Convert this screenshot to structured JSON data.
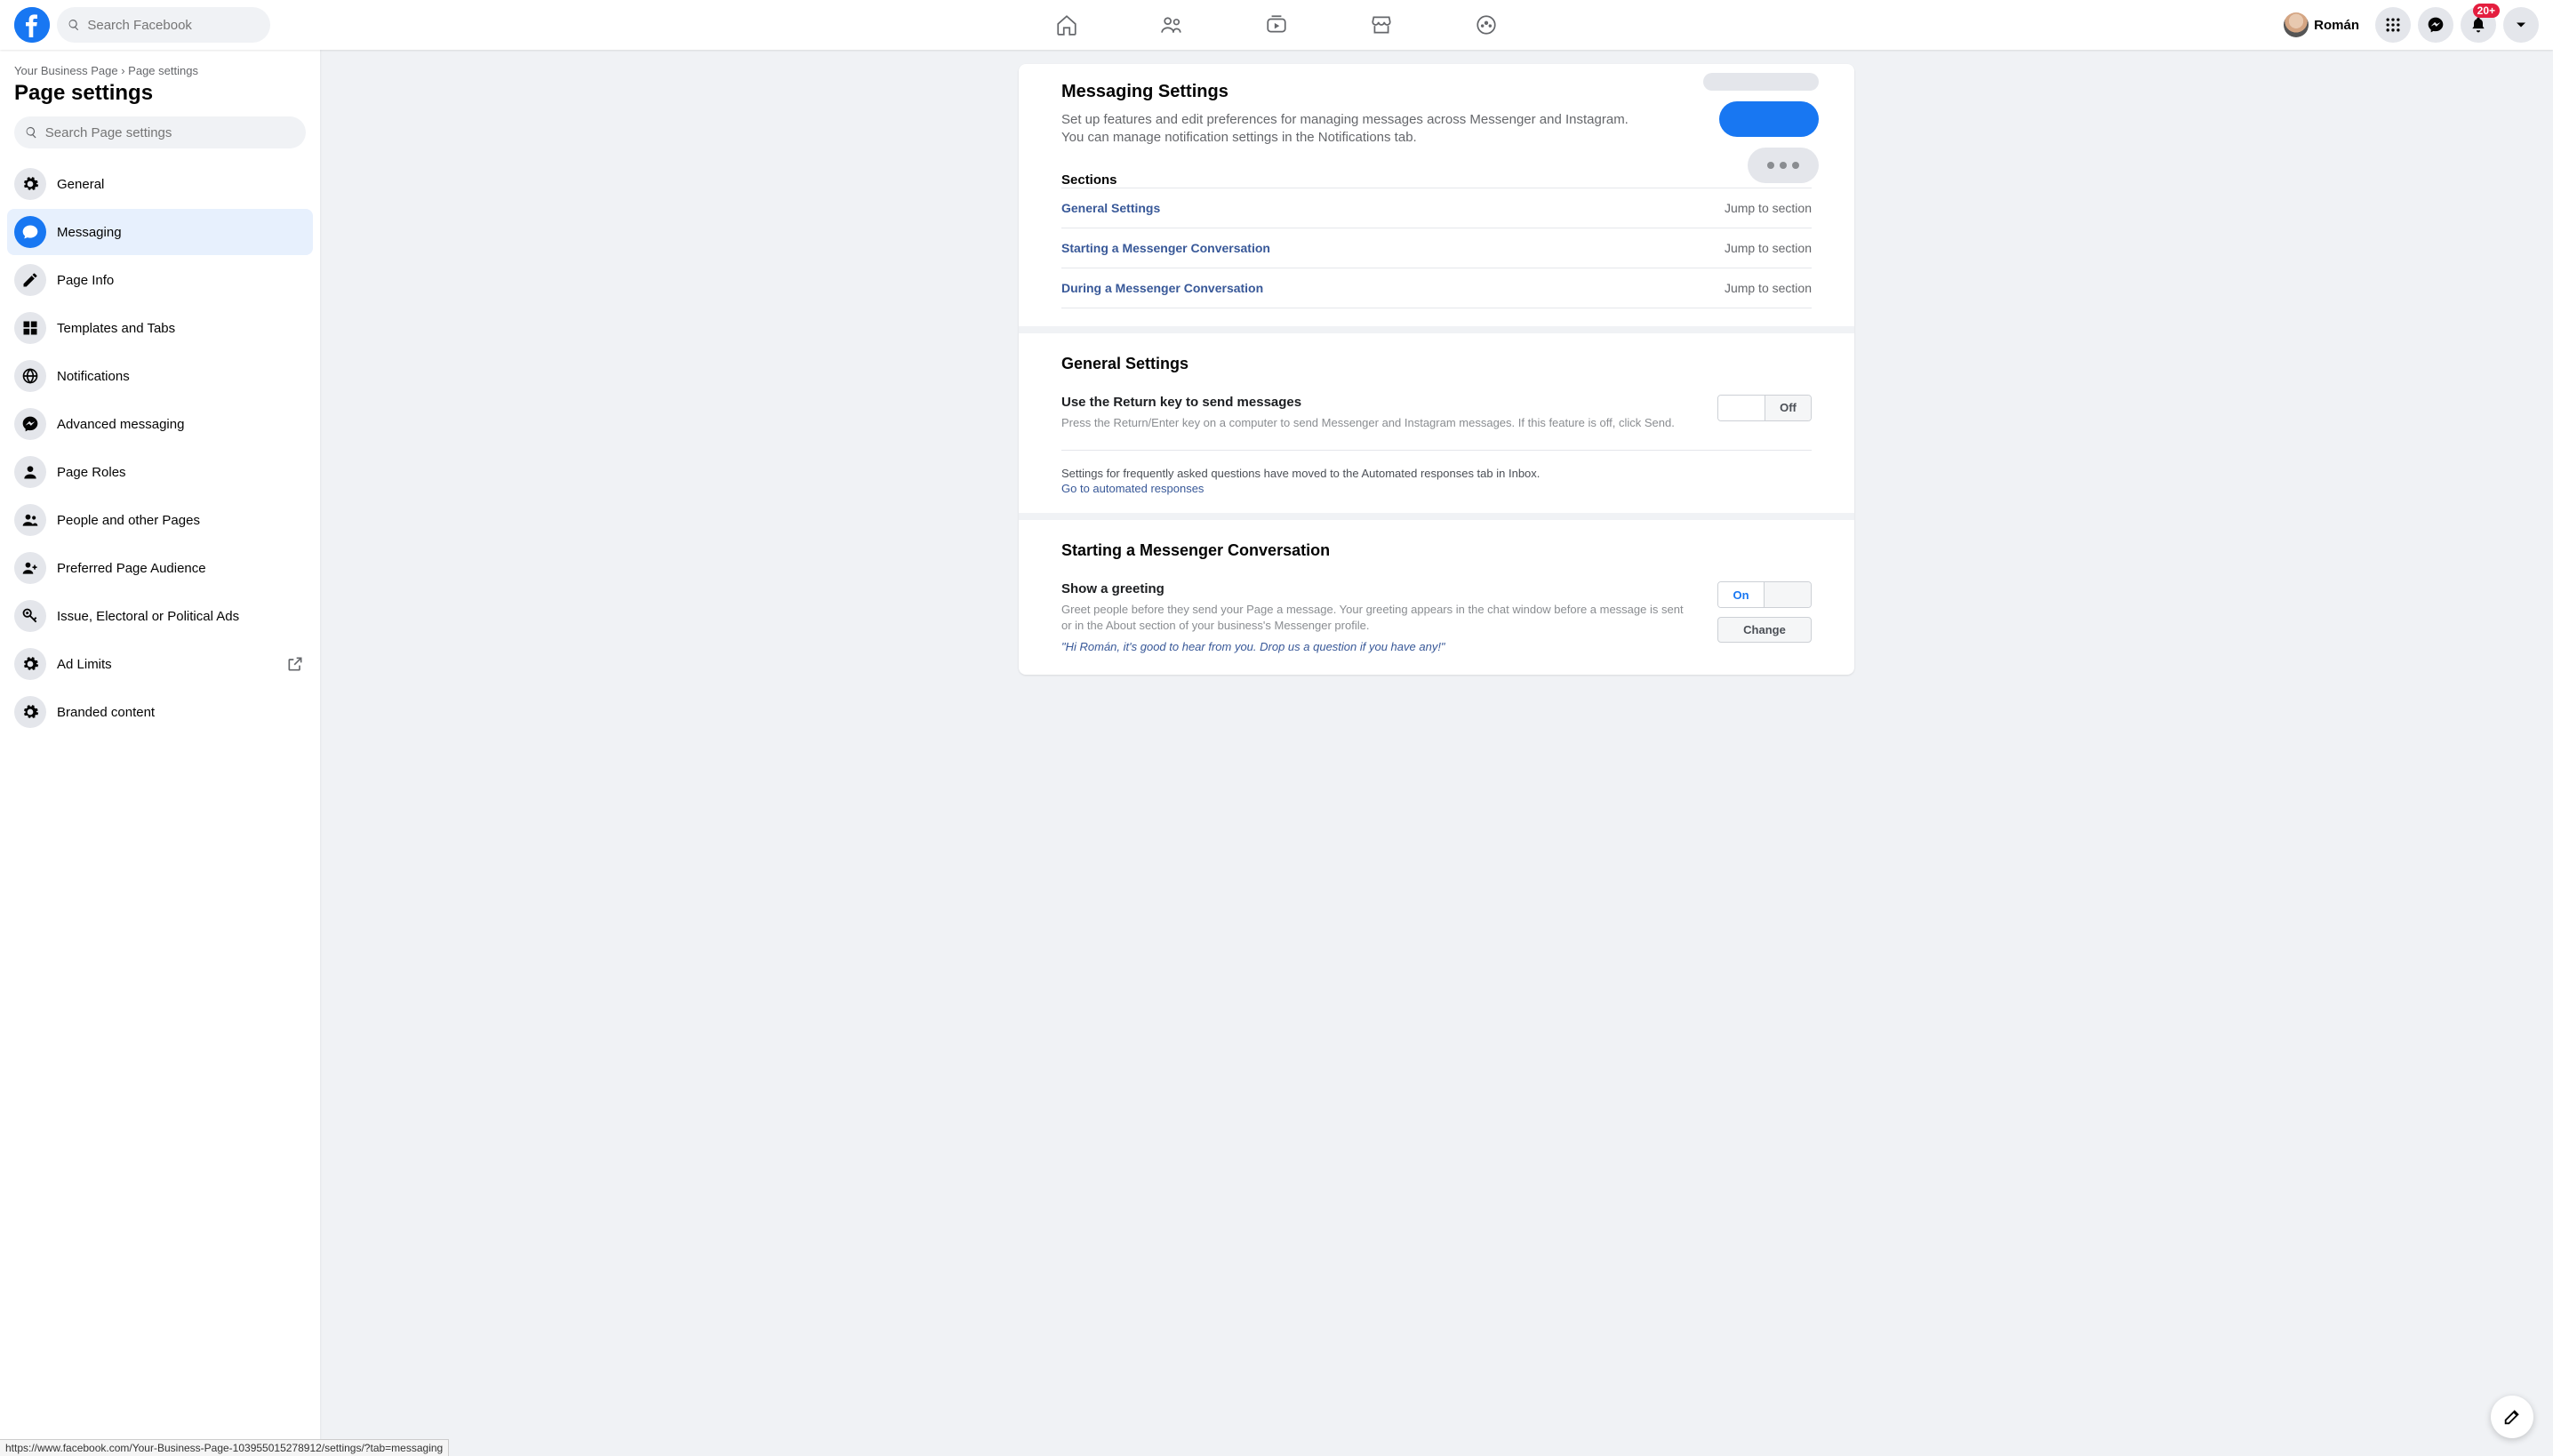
{
  "topnav": {
    "search_placeholder": "Search Facebook",
    "profile_name": "Román",
    "notification_badge": "20+"
  },
  "sidebar": {
    "breadcrumb_page": "Your Business Page",
    "breadcrumb_sep": " › ",
    "breadcrumb_current": "Page settings",
    "title": "Page settings",
    "search_placeholder": "Search Page settings",
    "items": [
      {
        "id": "general",
        "label": "General"
      },
      {
        "id": "messaging",
        "label": "Messaging",
        "active": true
      },
      {
        "id": "pageinfo",
        "label": "Page Info"
      },
      {
        "id": "templates",
        "label": "Templates and Tabs"
      },
      {
        "id": "notifications",
        "label": "Notifications"
      },
      {
        "id": "advmsg",
        "label": "Advanced messaging"
      },
      {
        "id": "roles",
        "label": "Page Roles"
      },
      {
        "id": "people",
        "label": "People and other Pages"
      },
      {
        "id": "audience",
        "label": "Preferred Page Audience"
      },
      {
        "id": "political",
        "label": "Issue, Electoral or Political Ads"
      },
      {
        "id": "adlimits",
        "label": "Ad Limits",
        "external": true
      },
      {
        "id": "branded",
        "label": "Branded content"
      }
    ]
  },
  "main": {
    "header_title": "Messaging Settings",
    "header_desc": "Set up features and edit preferences for managing messages across Messenger and Instagram. You can manage notification settings in the Notifications tab.",
    "sections_label": "Sections",
    "jump_label": "Jump to section",
    "sections": [
      {
        "label": "General Settings"
      },
      {
        "label": "Starting a Messenger Conversation"
      },
      {
        "label": "During a Messenger Conversation"
      }
    ],
    "general": {
      "heading": "General Settings",
      "return_key_title": "Use the Return key to send messages",
      "return_key_desc": "Press the Return/Enter key on a computer to send Messenger and Instagram messages. If this feature is off, click Send.",
      "return_key_state": "Off",
      "faq_note": "Settings for frequently asked questions have moved to the Automated responses tab in Inbox.",
      "faq_link": "Go to automated responses"
    },
    "starting": {
      "heading": "Starting a Messenger Conversation",
      "greeting_title": "Show a greeting",
      "greeting_desc": "Greet people before they send your Page a message. Your greeting appears in the chat window before a message is sent or in the About section of your business's Messenger profile.",
      "greeting_state": "On",
      "change_label": "Change",
      "greeting_sample": "\"Hi Román, it's good to hear from you. Drop us a question if you have any!\""
    }
  },
  "status_url": "https://www.facebook.com/Your-Business-Page-103955015278912/settings/?tab=messaging"
}
